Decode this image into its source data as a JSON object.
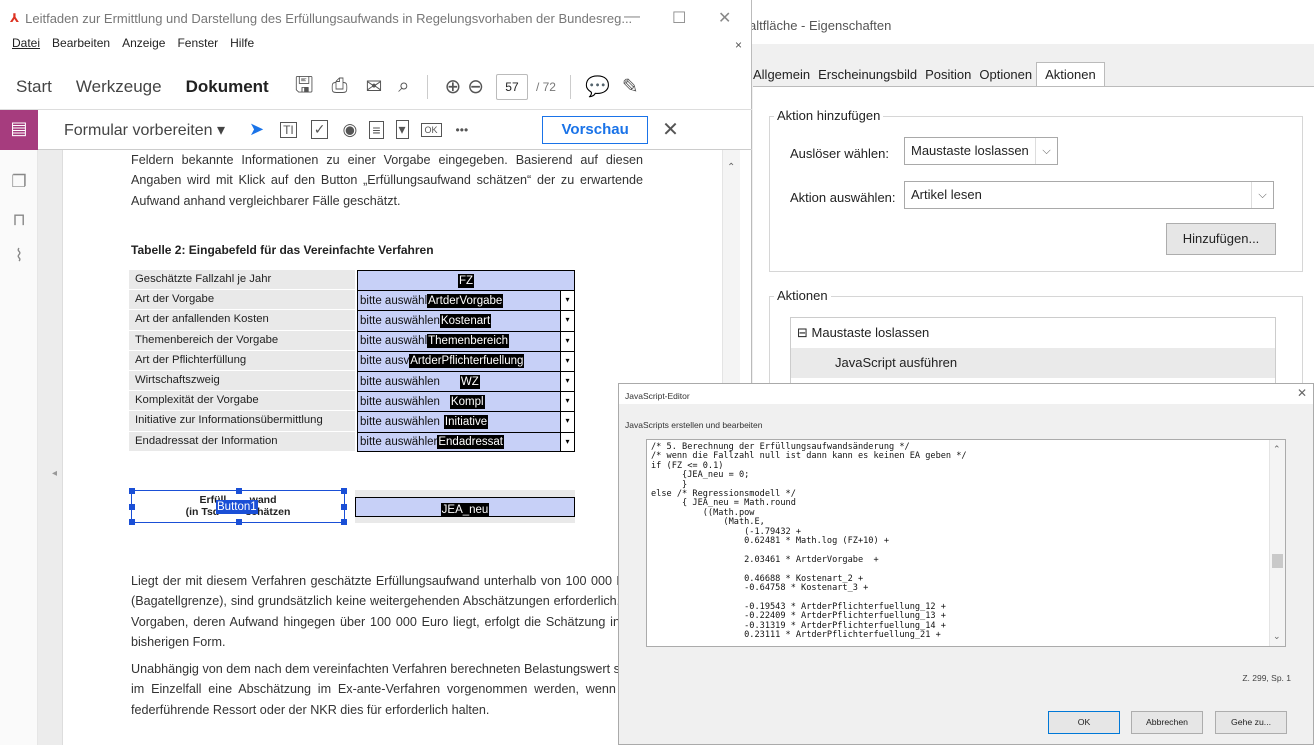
{
  "props": {
    "title": "altfläche - Eigenschaften",
    "tabs": [
      "Allgemein",
      "Erscheinungsbild",
      "Position",
      "Optionen",
      "Aktionen"
    ],
    "add_group_title": "Aktion hinzufügen",
    "trigger_label": "Auslöser wählen:",
    "trigger_value": "Maustaste loslassen",
    "action_label": "Aktion auswählen:",
    "action_value": "Artikel lesen",
    "add_button": "Hinzufügen...",
    "actions_group_title": "Aktionen",
    "tree": {
      "parent": "⊟ Maustaste loslassen",
      "child": "JavaScript ausführen"
    }
  },
  "acrobat": {
    "title": "Leitfaden zur Ermittlung und Darstellung des Erfüllungsaufwands in Regelungsvorhaben der Bundesreg...",
    "menu": [
      "Datei",
      "Bearbeiten",
      "Anzeige",
      "Fenster",
      "Hilfe"
    ],
    "tabs": {
      "start": "Start",
      "tools": "Werkzeuge",
      "document": "Dokument"
    },
    "page_current": "57",
    "page_total": "/ 72",
    "form_tool_label": "Formular vorbereiten ▾",
    "preview_button": "Vorschau",
    "ok_icon_text": "OK",
    "more_icon_text": "•••"
  },
  "doc": {
    "para_top": "Feldern bekannte Informationen zu einer Vorgabe eingegeben. Basierend auf diesen Angaben wird mit Klick auf den Button „Erfüllungsaufwand schätzen“ der zu erwartende Aufwand anhand vergleichbarer Fälle geschätzt.",
    "table_title": "Tabelle 2: Eingabefeld für das Vereinfachte Verfahren",
    "rows": [
      {
        "label": "Geschätzte Fallzahl je Jahr",
        "hint": "",
        "field": "FZ",
        "dropdown": false
      },
      {
        "label": "Art der Vorgabe",
        "hint": "bitte auswähl",
        "field": "ArtderVorgabe",
        "dropdown": true
      },
      {
        "label": "Art der anfallenden Kosten",
        "hint": "bitte auswählen",
        "field": "Kostenart",
        "dropdown": true
      },
      {
        "label": "Themenbereich der Vorgabe",
        "hint": "bitte auswähl",
        "field": "Themenbereich",
        "dropdown": true
      },
      {
        "label": "Art der Pflichterfüllung",
        "hint": "bitte ausv",
        "field": "ArtderPflichterfuellung",
        "dropdown": true
      },
      {
        "label": "Wirtschaftszweig",
        "hint": "bitte auswählen",
        "field": "WZ",
        "dropdown": true
      },
      {
        "label": "Komplexität der Vorgabe",
        "hint": "bitte auswählen",
        "field": "Kompl",
        "dropdown": true
      },
      {
        "label": "Initiative zur Informationsübermittlung",
        "hint": "bitte auswählen",
        "field": "Initiative",
        "dropdown": true
      },
      {
        "label": "Endadressat der Information",
        "hint": "bitte auswähler",
        "field": "Endadressat",
        "dropdown": true
      }
    ],
    "button_line1": "Erfüll        wand",
    "button_line2": "(in Tsd         schätzen",
    "button_field": "Button1",
    "result_field": "JEA_neu",
    "para_mid": "Liegt der mit diesem Verfahren geschätzte Erfüllungsaufwand unterhalb von 100 000 Euro (Bagatellgrenze), sind grundsätzlich keine weitergehenden Abschätzungen erforderlich. Für Vorgaben, deren Aufwand hingegen über 100 000 Euro liegt, erfolgt die Schätzung in der bisherigen Form.",
    "para_bottom": "Unabhängig von dem nach dem vereinfachten Verfahren berechneten Belastungswert sollte im Einzelfall eine Abschätzung im Ex-ante-Verfahren vorgenommen werden, wenn das federführende Ressort oder der NKR dies für erforderlich halten."
  },
  "jsedit": {
    "title": "JavaScript-Editor",
    "subtitle": "JavaScripts erstellen und bearbeiten",
    "code": "/* 5. Berechnung der Erfüllungsaufwandsänderung */\n/* wenn die Fallzahl null ist dann kann es keinen EA geben */\nif (FZ <= 0.1)\n      {JEA_neu = 0;\n      }\nelse /* Regressionsmodell */\n      { JEA_neu = Math.round\n          ((Math.pow\n              (Math.E,\n                  (-1.79432 +\n                  0.62481 * Math.log (FZ+10) +\n\n                  2.03461 * ArtderVorgabe  +\n\n                  0.46688 * Kostenart_2 +\n                  -0.64758 * Kostenart_3 +\n\n                  -0.19543 * ArtderPflichterfuellung_12 +\n                  -0.22409 * ArtderPflichterfuellung_13 +\n                  -0.31319 * ArtderPflichterfuellung_14 +\n                  0.23111 * ArtderPflichterfuellung_21 +",
    "status": "Z. 299, Sp. 1",
    "ok": "OK",
    "cancel": "Abbrechen",
    "goto": "Gehe zu..."
  },
  "colors": {
    "accent_purple": "#a63c7e",
    "field_blue": "#c7d0f7",
    "selection_blue": "#1a4fd6"
  }
}
